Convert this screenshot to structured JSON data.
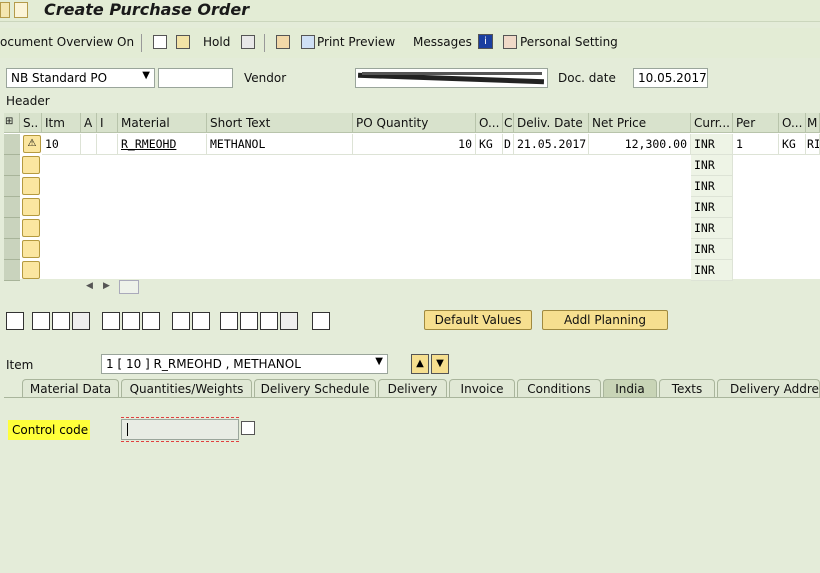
{
  "window": {
    "title": "Create Purchase Order"
  },
  "toolbar": {
    "document_overview": "ocument Overview On",
    "hold": "Hold",
    "print_preview": "Print Preview",
    "messages": "Messages",
    "personal_setting": "Personal Setting"
  },
  "header": {
    "po_type": "NB Standard PO",
    "vendor_label": "Vendor",
    "vendor_value": "",
    "doc_date_label": "Doc. date",
    "doc_date_value": "10.05.2017",
    "header_label": "Header"
  },
  "table": {
    "columns": [
      "S..",
      "Itm",
      "A",
      "I",
      "Material",
      "Short Text",
      "PO Quantity",
      "O...",
      "C",
      "Deliv. Date",
      "Net Price",
      "Curr...",
      "Per",
      "O...",
      "M"
    ],
    "row1": {
      "itm": "10",
      "material": "R_RMEOHD",
      "short_text": "METHANOL",
      "quantity": "10",
      "unit": "KG",
      "c": "D",
      "deliv_date": "21.05.2017",
      "net_price": "12,300.00",
      "currency": "INR",
      "per": "1",
      "order_unit": "KG",
      "m": "RI"
    },
    "empty_currency": "INR"
  },
  "buttons": {
    "default_values": "Default Values",
    "addl_planning": "Addl Planning"
  },
  "item": {
    "label": "Item",
    "selected": "1 [ 10 ] R_RMEOHD , METHANOL"
  },
  "tabs": [
    "Material Data",
    "Quantities/Weights",
    "Delivery Schedule",
    "Delivery",
    "Invoice",
    "Conditions",
    "India",
    "Texts",
    "Delivery Address"
  ],
  "india_tab": {
    "control_code_label": "Control code",
    "control_code_value": ""
  },
  "colors": {
    "highlight": "#ffff3a",
    "background": "#e4ecd9"
  }
}
